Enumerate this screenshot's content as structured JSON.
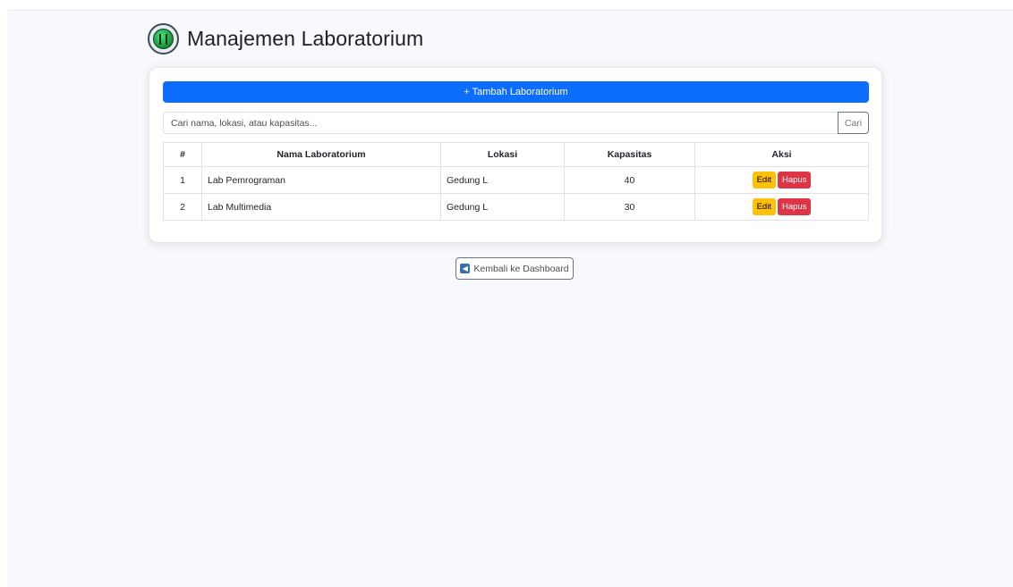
{
  "header": {
    "title": "Manajemen Laboratorium",
    "logo_icon": "university-seal-icon"
  },
  "toolbar": {
    "add_label": "+ Tambah Laboratorium"
  },
  "search": {
    "placeholder": "Cari nama, lokasi, atau kapasitas...",
    "button_label": "Cari"
  },
  "table": {
    "headers": [
      "#",
      "Nama Laboratorium",
      "Lokasi",
      "Kapasitas",
      "Aksi"
    ],
    "rows": [
      {
        "no": "1",
        "name": "Lab Pemrograman",
        "location": "Gedung L",
        "capacity": "40",
        "edit_label": "Edit",
        "delete_label": "Hapus"
      },
      {
        "no": "2",
        "name": "Lab Multimedia",
        "location": "Gedung L",
        "capacity": "30",
        "edit_label": "Edit",
        "delete_label": "Hapus"
      }
    ]
  },
  "footer": {
    "back_label": "Kembali ke Dashboard",
    "back_icon": "arrow-left-square-icon"
  },
  "colors": {
    "primary": "#0d6efd",
    "warning": "#ffc107",
    "danger": "#dc3545",
    "secondary": "#6c757d"
  }
}
